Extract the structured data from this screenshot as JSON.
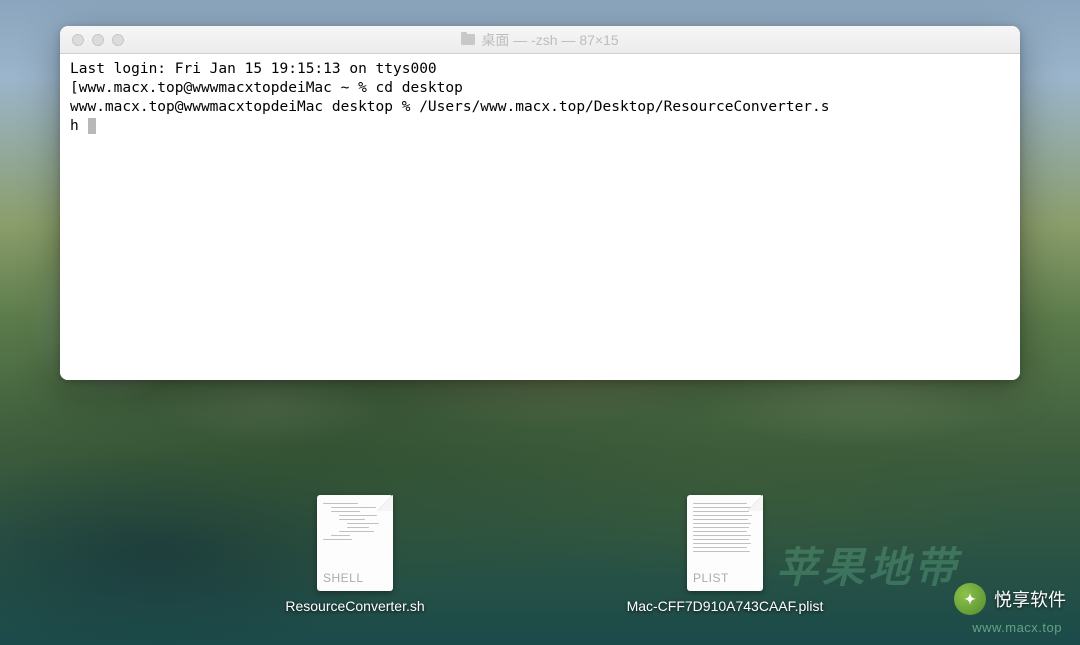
{
  "window": {
    "title": "桌面 — -zsh — 87×15"
  },
  "terminal": {
    "line1": "Last login: Fri Jan 15 19:15:13 on ttys000",
    "line2": "[www.macx.top@wwwmacxtopdeiMac ~ % cd desktop",
    "line3": "www.macx.top@wwwmacxtopdeiMac desktop % /Users/www.macx.top/Desktop/ResourceConverter.s",
    "line4": "h "
  },
  "files": [
    {
      "name": "ResourceConverter.sh",
      "type_label": "SHELL"
    },
    {
      "name": "Mac-CFF7D910A743CAAF.plist",
      "type_label": "PLIST"
    }
  ],
  "watermark": {
    "background_text": "苹果地带",
    "brand": "悦享软件",
    "url": "www.macx.top"
  }
}
